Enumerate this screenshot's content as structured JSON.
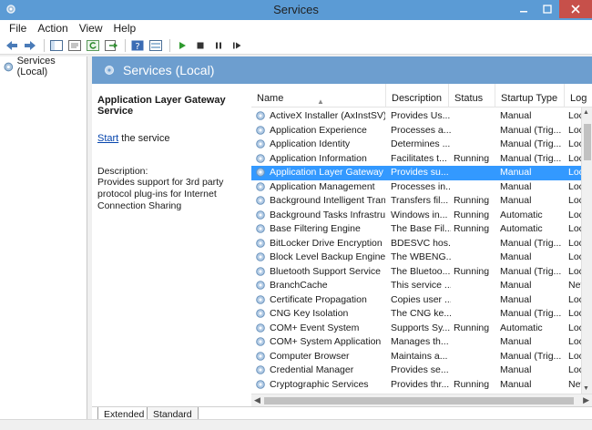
{
  "window": {
    "title": "Services"
  },
  "menu": {
    "items": [
      "File",
      "Action",
      "View",
      "Help"
    ]
  },
  "tree": {
    "root_label": "Services (Local)"
  },
  "header": {
    "title": "Services (Local)"
  },
  "detail": {
    "service_name": "Application Layer Gateway Service",
    "start_link": "Start",
    "start_suffix": " the service",
    "description_label": "Description:",
    "description_text": "Provides support for 3rd party protocol plug-ins for Internet Connection Sharing"
  },
  "table": {
    "columns": {
      "name": "Name",
      "description": "Description",
      "status": "Status",
      "startup": "Startup Type",
      "logon": "Log"
    },
    "rows": [
      {
        "name": "ActiveX Installer (AxInstSV)",
        "description": "Provides Us...",
        "status": "",
        "startup": "Manual",
        "logon": "Loc"
      },
      {
        "name": "Application Experience",
        "description": "Processes a...",
        "status": "",
        "startup": "Manual (Trig...",
        "logon": "Loc"
      },
      {
        "name": "Application Identity",
        "description": "Determines ...",
        "status": "",
        "startup": "Manual (Trig...",
        "logon": "Loc"
      },
      {
        "name": "Application Information",
        "description": "Facilitates t...",
        "status": "Running",
        "startup": "Manual (Trig...",
        "logon": "Loc"
      },
      {
        "name": "Application Layer Gateway ...",
        "description": "Provides su...",
        "status": "",
        "startup": "Manual",
        "logon": "Loc"
      },
      {
        "name": "Application Management",
        "description": "Processes in...",
        "status": "",
        "startup": "Manual",
        "logon": "Loc"
      },
      {
        "name": "Background Intelligent Tran...",
        "description": "Transfers fil...",
        "status": "Running",
        "startup": "Manual",
        "logon": "Loc"
      },
      {
        "name": "Background Tasks Infrastru...",
        "description": "Windows in...",
        "status": "Running",
        "startup": "Automatic",
        "logon": "Loc"
      },
      {
        "name": "Base Filtering Engine",
        "description": "The Base Fil...",
        "status": "Running",
        "startup": "Automatic",
        "logon": "Loc"
      },
      {
        "name": "BitLocker Drive Encryption ...",
        "description": "BDESVC hos...",
        "status": "",
        "startup": "Manual (Trig...",
        "logon": "Loc"
      },
      {
        "name": "Block Level Backup Engine ...",
        "description": "The WBENG...",
        "status": "",
        "startup": "Manual",
        "logon": "Loc"
      },
      {
        "name": "Bluetooth Support Service",
        "description": "The Bluetoo...",
        "status": "Running",
        "startup": "Manual (Trig...",
        "logon": "Loc"
      },
      {
        "name": "BranchCache",
        "description": "This service ...",
        "status": "",
        "startup": "Manual",
        "logon": "Net"
      },
      {
        "name": "Certificate Propagation",
        "description": "Copies user ...",
        "status": "",
        "startup": "Manual",
        "logon": "Loc"
      },
      {
        "name": "CNG Key Isolation",
        "description": "The CNG ke...",
        "status": "",
        "startup": "Manual (Trig...",
        "logon": "Loc"
      },
      {
        "name": "COM+ Event System",
        "description": "Supports Sy...",
        "status": "Running",
        "startup": "Automatic",
        "logon": "Loc"
      },
      {
        "name": "COM+ System Application",
        "description": "Manages th...",
        "status": "",
        "startup": "Manual",
        "logon": "Loc"
      },
      {
        "name": "Computer Browser",
        "description": "Maintains a...",
        "status": "",
        "startup": "Manual (Trig...",
        "logon": "Loc"
      },
      {
        "name": "Credential Manager",
        "description": "Provides se...",
        "status": "",
        "startup": "Manual",
        "logon": "Loc"
      },
      {
        "name": "Cryptographic Services",
        "description": "Provides thr...",
        "status": "Running",
        "startup": "Manual",
        "logon": "Net"
      }
    ],
    "selected_index": 4
  },
  "tabs": {
    "extended": "Extended",
    "standard": "Standard"
  },
  "colors": {
    "titlebar": "#5b9bd5",
    "header_band": "#6d9ecf",
    "selection": "#3399ff",
    "close_button": "#c7504a",
    "link": "#0645ad"
  },
  "icons": [
    "gear-service-icon",
    "back-arrow-icon",
    "forward-arrow-icon",
    "console-tree-icon",
    "properties-icon",
    "refresh-icon",
    "export-icon",
    "help-icon",
    "view-icon",
    "play-icon",
    "stop-icon",
    "pause-icon",
    "resume-icon"
  ]
}
